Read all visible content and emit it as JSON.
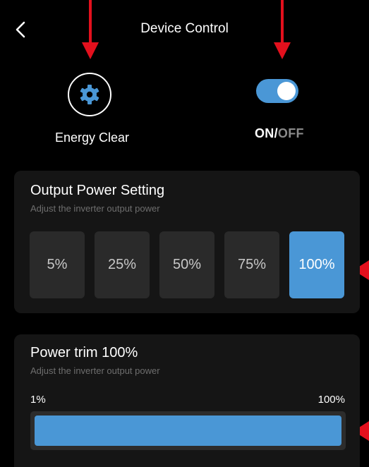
{
  "header": {
    "title": "Device Control",
    "back_icon": "chevron-left-icon"
  },
  "energy_clear": {
    "icon": "gear-icon",
    "label": "Energy Clear"
  },
  "power_toggle": {
    "state": "on",
    "on_label": "ON",
    "separator": "/",
    "off_label": "OFF"
  },
  "output_power": {
    "title": "Output Power Setting",
    "subtitle": "Adjust the inverter output power",
    "options": [
      "5%",
      "25%",
      "50%",
      "75%",
      "100%"
    ],
    "selected": "100%"
  },
  "power_trim": {
    "title": "Power trim 100%",
    "subtitle": "Adjust the inverter output power",
    "min_label": "1%",
    "max_label": "100%",
    "value_percent": 100
  },
  "colors": {
    "accent": "#4a97d6",
    "background": "#000000",
    "card": "#151515",
    "annotation": "#e3101d"
  }
}
